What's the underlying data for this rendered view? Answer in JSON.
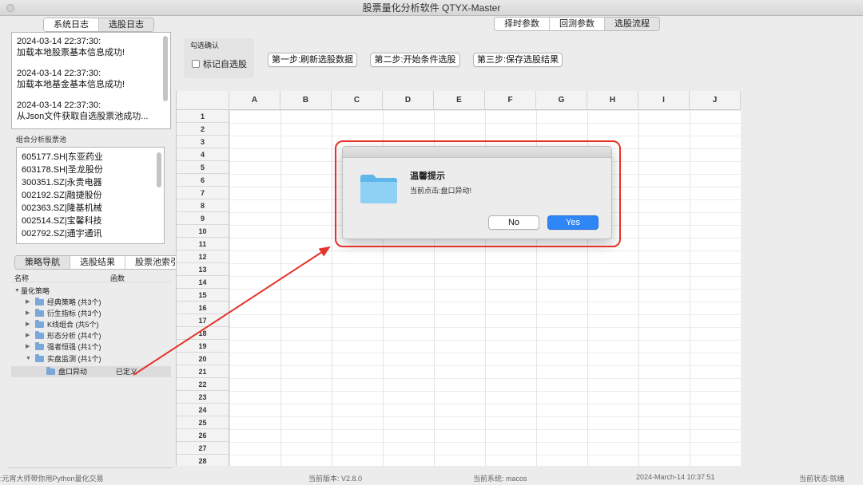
{
  "window": {
    "title": "股票量化分析软件 QTYX-Master"
  },
  "log_tabs": [
    "系统日志",
    "选股日志"
  ],
  "log_entries": [
    {
      "time": "2024-03-14 22:37:30:",
      "message": "加载本地股票基本信息成功!"
    },
    {
      "time": "2024-03-14 22:37:30:",
      "message": "加载本地基金基本信息成功!"
    },
    {
      "time": "2024-03-14 22:37:30:",
      "message": "从Json文件获取自选股票池成功..."
    }
  ],
  "stock_pool": {
    "label": "组合分析股票池",
    "items": [
      "605177.SH|东亚药业",
      "603178.SH|圣龙股份",
      "300351.SZ|永贵电器",
      "002192.SZ|融捷股份",
      "002363.SZ|隆基机械",
      "002514.SZ|宝馨科技",
      "002792.SZ|通宇通讯"
    ]
  },
  "nav_tabs": [
    "策略导航",
    "选股结果",
    "股票池索引"
  ],
  "tree": {
    "col_name": "名称",
    "col_func": "函数",
    "root": "量化策略",
    "nodes": [
      "经典策略 (共3个)",
      "衍生指标 (共3个)",
      "K线组合 (共5个)",
      "形态分析 (共4个)",
      "强者恒强 (共1个)",
      "实盘监测 (共1个)"
    ],
    "selected": {
      "name": "盘口异动",
      "func": "已定义"
    }
  },
  "top_tabs": [
    "择时参数",
    "回测参数",
    "选股流程"
  ],
  "confirm": {
    "label": "勾选确认",
    "checkbox": "标记自选股"
  },
  "steps": [
    "第一步:刷新选股数据",
    "第二步:开始条件选股",
    "第三步:保存选股结果"
  ],
  "grid": {
    "columns": [
      "A",
      "B",
      "C",
      "D",
      "E",
      "F",
      "G",
      "H",
      "I",
      "J"
    ],
    "rows": [
      "1",
      "2",
      "3",
      "4",
      "5",
      "6",
      "7",
      "8",
      "9",
      "10",
      "11",
      "12",
      "13",
      "14",
      "15",
      "16",
      "17",
      "18",
      "19",
      "20",
      "21",
      "22",
      "23",
      "24",
      "25",
      "26",
      "27",
      "28"
    ]
  },
  "dialog": {
    "title": "温馨提示",
    "message": "当前点击:盘口异动!",
    "no_label": "No",
    "yes_label": "Yes"
  },
  "status": {
    "left": ":元宵大师带你用Python量化交易",
    "version": "当前版本: V2.8.0",
    "system": "当前系统: macos",
    "datetime": "2024-March-14 10:37:51",
    "state": "当前状态:就绪"
  },
  "colors": {
    "accent": "#2f86f6",
    "annotation": "#e5332a",
    "folder": "#7aa8d8"
  }
}
